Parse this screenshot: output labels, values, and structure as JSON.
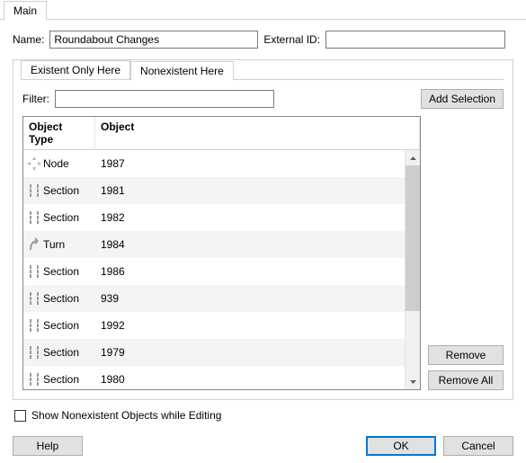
{
  "tabs": {
    "main_label": "Main"
  },
  "fields": {
    "name_label": "Name:",
    "name_value": "Roundabout Changes",
    "externalid_label": "External ID:",
    "externalid_value": ""
  },
  "subtabs": {
    "existent_label": "Existent Only Here",
    "nonexistent_label": "Nonexistent Here",
    "active": "nonexistent"
  },
  "filter": {
    "label": "Filter:",
    "value": ""
  },
  "buttons": {
    "add_selection": "Add Selection",
    "remove": "Remove",
    "remove_all": "Remove All",
    "help": "Help",
    "ok": "OK",
    "cancel": "Cancel"
  },
  "columns": {
    "object_type": "Object Type",
    "object": "Object"
  },
  "rows": [
    {
      "icon": "node",
      "type": "Node",
      "object": "1987"
    },
    {
      "icon": "section",
      "type": "Section",
      "object": "1981"
    },
    {
      "icon": "section",
      "type": "Section",
      "object": "1982"
    },
    {
      "icon": "turn",
      "type": "Turn",
      "object": "1984"
    },
    {
      "icon": "section",
      "type": "Section",
      "object": "1986"
    },
    {
      "icon": "section",
      "type": "Section",
      "object": "939"
    },
    {
      "icon": "section",
      "type": "Section",
      "object": "1992"
    },
    {
      "icon": "section",
      "type": "Section",
      "object": "1979"
    },
    {
      "icon": "section",
      "type": "Section",
      "object": "1980"
    }
  ],
  "checkbox": {
    "show_nonexistent_label": "Show Nonexistent Objects while Editing",
    "checked": false
  }
}
